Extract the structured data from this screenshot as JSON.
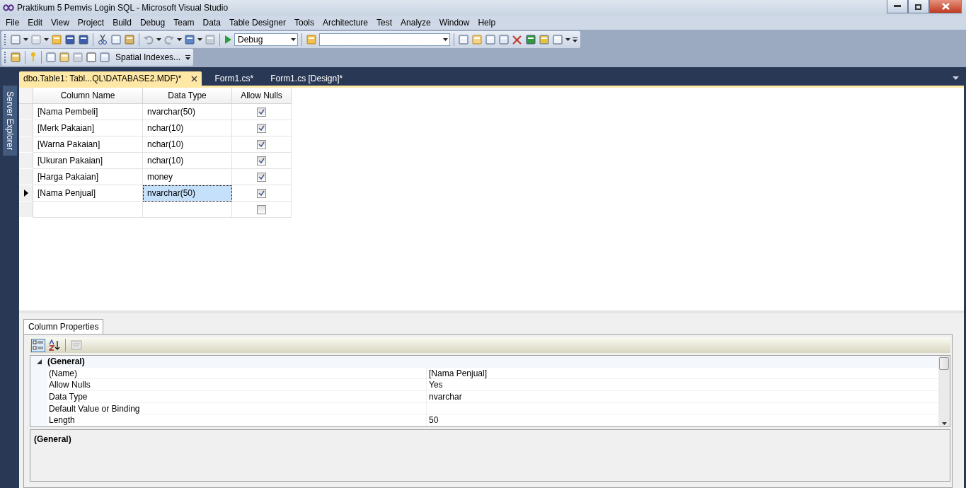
{
  "window": {
    "title": "Praktikum 5 Pemvis Login SQL - Microsoft Visual Studio"
  },
  "menu": [
    "File",
    "Edit",
    "View",
    "Project",
    "Build",
    "Debug",
    "Team",
    "Data",
    "Table Designer",
    "Tools",
    "Architecture",
    "Test",
    "Analyze",
    "Window",
    "Help"
  ],
  "toolbar": {
    "configuration": "Debug"
  },
  "toolbar2": {
    "button": "Spatial Indexes..."
  },
  "side_tab": "Server Explorer",
  "tabs": [
    {
      "label": "dbo.Table1: Tabl...QL\\DATABASE2.MDF)*",
      "selected": true
    },
    {
      "label": "Form1.cs*",
      "selected": false
    },
    {
      "label": "Form1.cs [Design]*",
      "selected": false
    }
  ],
  "table": {
    "columns": [
      "Column Name",
      "Data Type",
      "Allow Nulls"
    ],
    "rows": [
      {
        "name": "[Nama Pembeli]",
        "type": "nvarchar(50)",
        "allow_nulls": true,
        "selected": false
      },
      {
        "name": "[Merk Pakaian]",
        "type": "nchar(10)",
        "allow_nulls": true,
        "selected": false
      },
      {
        "name": "[Warna Pakaian]",
        "type": "nchar(10)",
        "allow_nulls": true,
        "selected": false
      },
      {
        "name": "[Ukuran Pakaian]",
        "type": "nchar(10)",
        "allow_nulls": true,
        "selected": false
      },
      {
        "name": "[Harga Pakaian]",
        "type": "money",
        "allow_nulls": true,
        "selected": false
      },
      {
        "name": "[Nama Penjual]",
        "type": "nvarchar(50)",
        "allow_nulls": true,
        "selected": true
      },
      {
        "name": "",
        "type": "",
        "allow_nulls": false,
        "selected": false
      }
    ]
  },
  "properties": {
    "tab": "Column Properties",
    "category": "(General)",
    "expanded": true,
    "items": [
      {
        "name": "(Name)",
        "value": "[Nama Penjual]"
      },
      {
        "name": "Allow Nulls",
        "value": "Yes"
      },
      {
        "name": "Data Type",
        "value": "nvarchar"
      },
      {
        "name": "Default Value or Binding",
        "value": ""
      },
      {
        "name": "Length",
        "value": "50"
      }
    ],
    "description": "(General)"
  }
}
